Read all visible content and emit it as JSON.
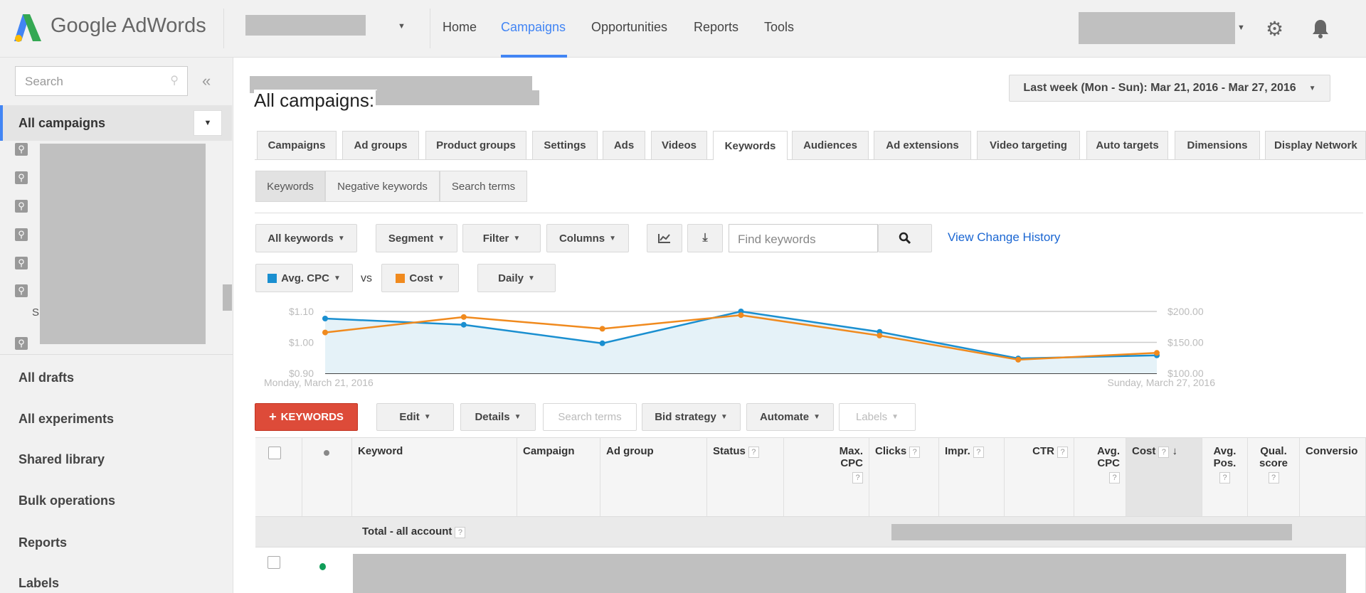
{
  "header": {
    "logo_text": "Google AdWords",
    "nav": [
      {
        "label": "Home"
      },
      {
        "label": "Campaigns",
        "active": true
      },
      {
        "label": "Opportunities"
      },
      {
        "label": "Reports"
      },
      {
        "label": "Tools"
      }
    ],
    "accent": "#4285f4"
  },
  "sidebar": {
    "search_placeholder": "Search",
    "collapse": "«",
    "current": "All campaigns",
    "list_letter": "S",
    "items": [
      {
        "label": "All drafts"
      },
      {
        "label": "All experiments"
      },
      {
        "label": "Shared library"
      },
      {
        "label": "Bulk operations"
      },
      {
        "label": "Reports"
      },
      {
        "label": "Labels"
      }
    ]
  },
  "main": {
    "title": "All campaigns:",
    "date_range": "Last week (Mon - Sun): Mar 21, 2016 - Mar 27, 2016",
    "tabs": [
      "Campaigns",
      "Ad groups",
      "Product groups",
      "Settings",
      "Ads",
      "Videos",
      "Keywords",
      "Audiences",
      "Ad extensions",
      "Video targeting",
      "Auto targets",
      "Dimensions",
      "Display Network"
    ],
    "active_tab": "Keywords",
    "subtabs": [
      "Keywords",
      "Negative keywords",
      "Search terms"
    ],
    "toolbar": {
      "all_keywords": "All keywords",
      "segment": "Segment",
      "filter": "Filter",
      "columns": "Columns",
      "search_placeholder": "Find keywords",
      "change_history": "View Change History"
    },
    "metrics": {
      "m1": "Avg. CPC",
      "vs": "vs",
      "m2": "Cost",
      "period": "Daily",
      "m1_color": "#1a8fd0",
      "m2_color": "#f08a1e"
    },
    "actions": {
      "add": "KEYWORDS",
      "edit": "Edit",
      "details": "Details",
      "search_terms": "Search terms",
      "bid_strategy": "Bid strategy",
      "automate": "Automate",
      "labels": "Labels",
      "add_color": "#dd4b39"
    },
    "table": {
      "columns": [
        "Keyword",
        "Campaign",
        "Ad group",
        "Status",
        "Max. CPC",
        "Clicks",
        "Impr.",
        "CTR",
        "Avg. CPC",
        "Cost",
        "Avg. Pos.",
        "Qual. score",
        "Conversio"
      ],
      "sorted_column": "Cost",
      "total_label": "Total - all account"
    }
  },
  "chart_data": {
    "type": "line",
    "x": [
      "2016-03-21",
      "2016-03-22",
      "2016-03-23",
      "2016-03-24",
      "2016-03-25",
      "2016-03-26",
      "2016-03-27"
    ],
    "x_start_label": "Monday, March 21, 2016",
    "x_end_label": "Sunday, March 27, 2016",
    "left_ticks": [
      "$0.90",
      "$1.00",
      "$1.10"
    ],
    "right_ticks": [
      "$100.00",
      "$150.00",
      "$200.00"
    ],
    "ylim_left": [
      0.9,
      1.1
    ],
    "ylim_right": [
      100,
      200
    ],
    "grid": true,
    "series": [
      {
        "name": "Avg. CPC",
        "axis": "left",
        "color": "#1a8fd0",
        "area": true,
        "values": [
          1.077,
          1.057,
          0.997,
          1.1,
          1.034,
          0.948,
          0.958
        ]
      },
      {
        "name": "Cost",
        "axis": "right",
        "color": "#f08a1e",
        "values": [
          166,
          191,
          172,
          194,
          161,
          122,
          133
        ]
      }
    ]
  }
}
